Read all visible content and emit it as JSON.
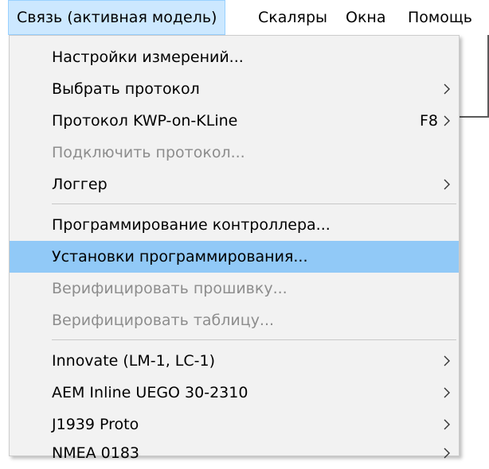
{
  "menubar": {
    "items": [
      {
        "label": "Связь (активная модель)",
        "active": true
      },
      {
        "label": "Скаляры",
        "active": false
      },
      {
        "label": "Окна",
        "active": false
      },
      {
        "label": "Помощь",
        "active": false
      }
    ]
  },
  "menu": {
    "items": [
      {
        "label": "Настройки измерений...",
        "shortcut": "",
        "submenu": false,
        "disabled": false,
        "highlighted": false
      },
      {
        "label": "Выбрать протокол",
        "shortcut": "",
        "submenu": true,
        "disabled": false,
        "highlighted": false
      },
      {
        "label": "Протокол KWP-on-KLine",
        "shortcut": "F8",
        "submenu": true,
        "disabled": false,
        "highlighted": false
      },
      {
        "label": "Подключить протокол...",
        "shortcut": "",
        "submenu": false,
        "disabled": true,
        "highlighted": false
      },
      {
        "label": "Логгер",
        "shortcut": "",
        "submenu": true,
        "disabled": false,
        "highlighted": false
      },
      {
        "label": "Программирование контроллера...",
        "shortcut": "",
        "submenu": false,
        "disabled": false,
        "highlighted": false
      },
      {
        "label": "Установки программирования...",
        "shortcut": "",
        "submenu": false,
        "disabled": false,
        "highlighted": true
      },
      {
        "label": "Верифицировать прошивку...",
        "shortcut": "",
        "submenu": false,
        "disabled": true,
        "highlighted": false
      },
      {
        "label": "Верифицировать таблицу...",
        "shortcut": "",
        "submenu": false,
        "disabled": true,
        "highlighted": false
      },
      {
        "label": "Innovate (LM-1, LC-1)",
        "shortcut": "",
        "submenu": true,
        "disabled": false,
        "highlighted": false
      },
      {
        "label": "AEM Inline UEGO 30-2310",
        "shortcut": "",
        "submenu": true,
        "disabled": false,
        "highlighted": false
      },
      {
        "label": "J1939 Proto",
        "shortcut": "",
        "submenu": true,
        "disabled": false,
        "highlighted": false
      },
      {
        "label": "NMEA 0183",
        "shortcut": "",
        "submenu": true,
        "disabled": false,
        "highlighted": false
      }
    ]
  },
  "colors": {
    "highlight": "#91c9f7",
    "menubar_active": "#cce8ff",
    "disabled_text": "#8d8d8d",
    "menu_background": "#f2f2f2"
  }
}
